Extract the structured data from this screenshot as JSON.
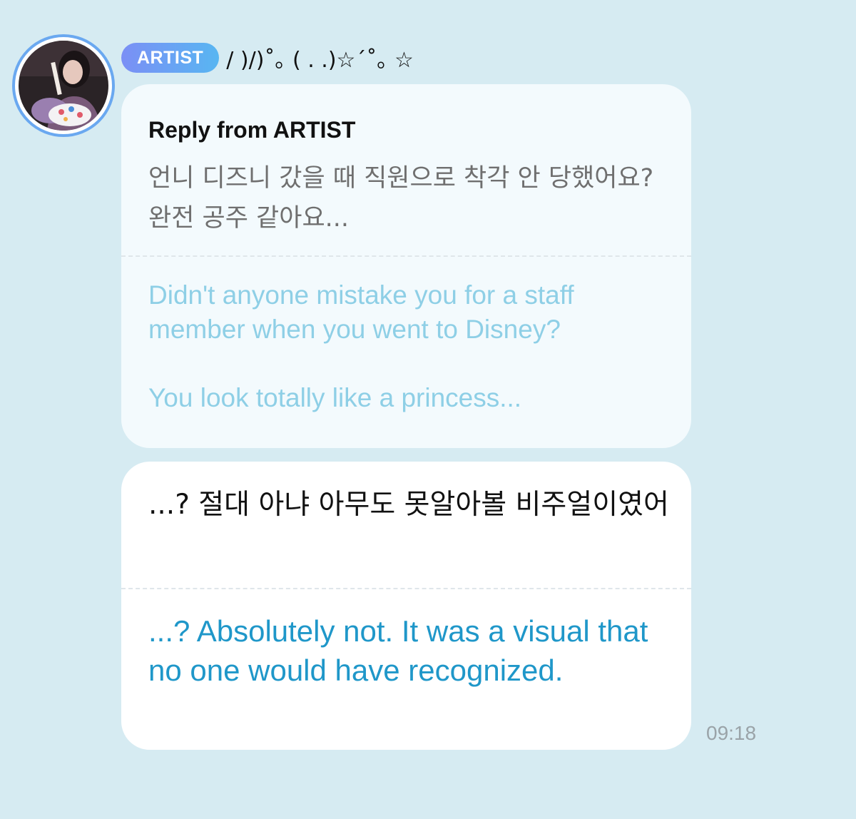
{
  "sender": {
    "badge": "ARTIST",
    "name": "/ )/)˚｡ ( . .)☆´˚｡ ☆"
  },
  "reply": {
    "title": "Reply from ARTIST",
    "original": "언니 디즈니 갔을 때 직원으로 착각 안 당했어요?  완전 공주 같아요...",
    "translation_1": "Didn't anyone mistake you for a staff member when you went to Disney?",
    "translation_2": "You look totally like a princess..."
  },
  "message": {
    "original": "...? 절대 아냐 아무도 못알아볼 비주얼이였어",
    "translation": "...? Absolutely not. It was a visual that no one would have recognized.",
    "time": "09:18"
  },
  "colors": {
    "background": "#d6ebf2",
    "badge_start": "#7b8ff5",
    "badge_end": "#58b6f2",
    "reply_translation": "#8ecfe6",
    "message_translation": "#1f97c9",
    "avatar_ring": "#6aa8f0"
  },
  "icons": {
    "avatar": "profile-photo"
  }
}
